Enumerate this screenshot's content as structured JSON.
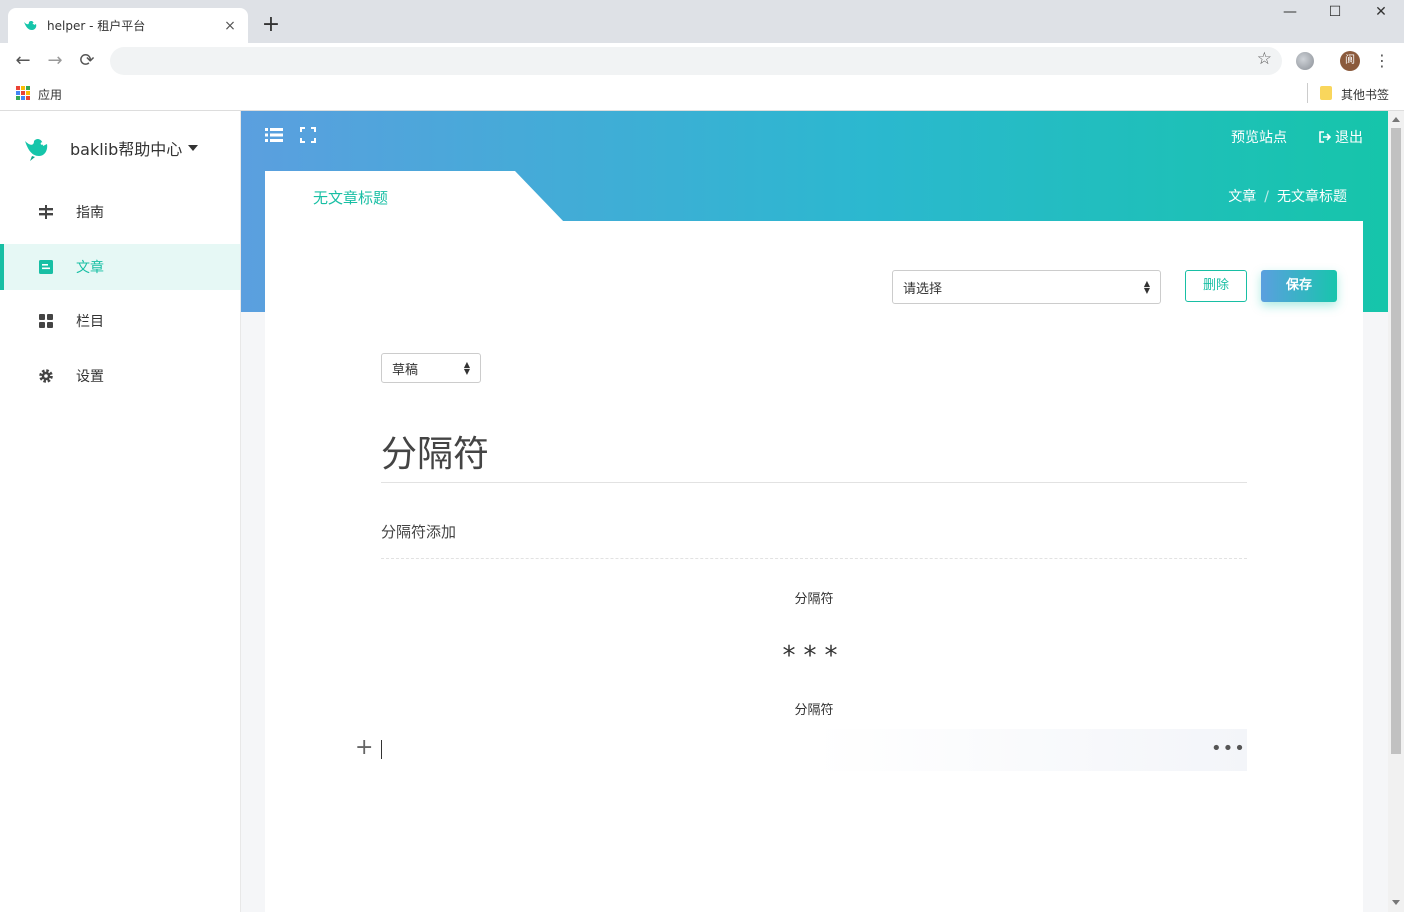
{
  "browser": {
    "tab_title": "helper - 租户平台",
    "tab_close": "×",
    "new_tab": "+",
    "win_minimize": "—",
    "win_maximize": "☐",
    "win_close": "✕",
    "back": "←",
    "forward": "→",
    "reload": "⟳",
    "star": "☆",
    "profile_initial": "阆",
    "menu": "⋮",
    "bookmark_apps": "应用",
    "bookmark_other": "其他书签"
  },
  "sidebar": {
    "brand": "baklib帮助中心",
    "items": [
      {
        "label": "指南",
        "icon": "signpost-icon"
      },
      {
        "label": "文章",
        "icon": "document-icon"
      },
      {
        "label": "栏目",
        "icon": "grid-icon"
      },
      {
        "label": "设置",
        "icon": "gear-icon"
      }
    ]
  },
  "header": {
    "preview_site": "预览站点",
    "logout": "退出"
  },
  "breadcrumb": {
    "parent": "文章",
    "separator": "/",
    "current": "无文章标题"
  },
  "page": {
    "tab_title": "无文章标题",
    "category_select": "请选择",
    "delete_label": "删除",
    "save_label": "保存",
    "status_select": "草稿"
  },
  "editor": {
    "title": "分隔符",
    "subtitle": "分隔符添加",
    "block_before": "分隔符",
    "separator_stars": "***",
    "block_after": "分隔符",
    "add_block": "+",
    "more": "•••"
  },
  "colors": {
    "accent": "#18bfa4",
    "banner_start": "#5b9fdf",
    "banner_end": "#16c5aa"
  }
}
